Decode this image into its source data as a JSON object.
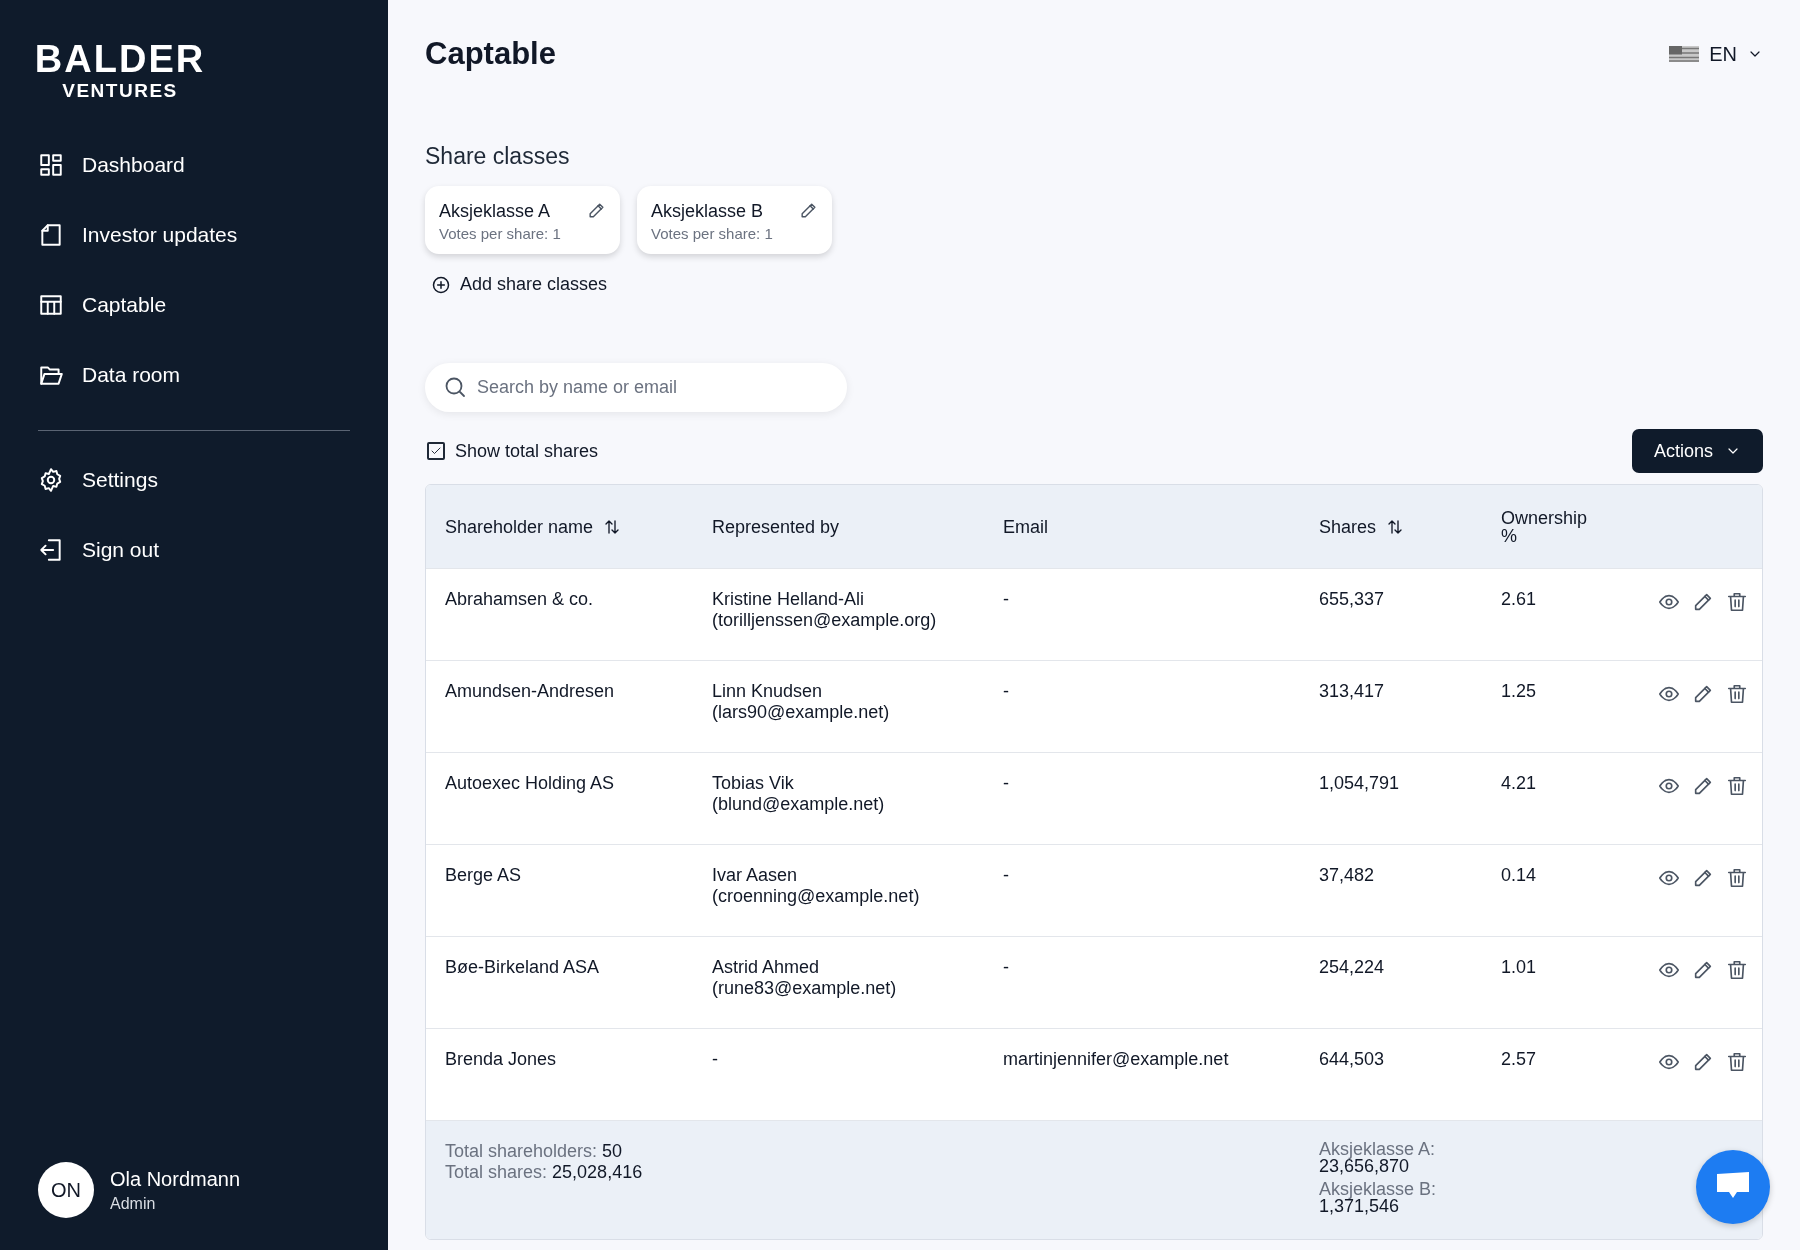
{
  "brand": {
    "name": "BALDER",
    "tagline": "VENTURES"
  },
  "nav": [
    {
      "label": "Dashboard"
    },
    {
      "label": "Investor updates"
    },
    {
      "label": "Captable"
    },
    {
      "label": "Data room"
    }
  ],
  "nav_secondary": [
    {
      "label": "Settings"
    },
    {
      "label": "Sign out"
    }
  ],
  "user": {
    "initials": "ON",
    "name": "Ola Nordmann",
    "role": "Admin"
  },
  "page_title": "Captable",
  "language": {
    "code": "EN"
  },
  "share_classes": {
    "heading": "Share classes",
    "items": [
      {
        "name": "Aksjeklasse A",
        "votes": "Votes per share: 1"
      },
      {
        "name": "Aksjeklasse B",
        "votes": "Votes per share: 1"
      }
    ],
    "add_label": "Add share classes"
  },
  "search": {
    "placeholder": "Search by name or email"
  },
  "show_total": {
    "label": "Show total shares",
    "checked": true
  },
  "actions_button": "Actions",
  "table": {
    "columns": [
      {
        "label": "Shareholder name",
        "sortable": true
      },
      {
        "label": "Represented by",
        "sortable": false
      },
      {
        "label": "Email",
        "sortable": false
      },
      {
        "label": "Shares",
        "sortable": true
      },
      {
        "label": "Ownership %",
        "sortable": false
      }
    ],
    "rows": [
      {
        "name": "Abrahamsen & co.",
        "represented": "Kristine Helland-Ali",
        "represented_email": "(torilljenssen@example.org)",
        "email": "-",
        "shares": "655,337",
        "ownership": "2.61"
      },
      {
        "name": "Amundsen-Andresen",
        "represented": "Linn Knudsen",
        "represented_email": "(lars90@example.net)",
        "email": "-",
        "shares": "313,417",
        "ownership": "1.25"
      },
      {
        "name": "Autoexec Holding AS",
        "represented": "Tobias Vik",
        "represented_email": "(blund@example.net)",
        "email": "-",
        "shares": "1,054,791",
        "ownership": "4.21"
      },
      {
        "name": "Berge AS",
        "represented": "Ivar Aasen",
        "represented_email": "(croenning@example.net)",
        "email": "-",
        "shares": "37,482",
        "ownership": "0.14"
      },
      {
        "name": "Bøe-Birkeland ASA",
        "represented": "Astrid Ahmed",
        "represented_email": "(rune83@example.net)",
        "email": "-",
        "shares": "254,224",
        "ownership": "1.01"
      },
      {
        "name": "Brenda Jones",
        "represented": "-",
        "email": "martinjennifer@example.net",
        "shares": "644,503",
        "ownership": "2.57"
      }
    ],
    "footer": {
      "totals": [
        {
          "label": "Total shareholders:",
          "value": "50"
        },
        {
          "label": "Total shares:",
          "value": "25,028,416"
        }
      ],
      "class_totals": [
        {
          "label": "Aksjeklasse A:",
          "value": "23,656,870"
        },
        {
          "label": "Aksjeklasse B:",
          "value": "1,371,546"
        }
      ]
    }
  }
}
